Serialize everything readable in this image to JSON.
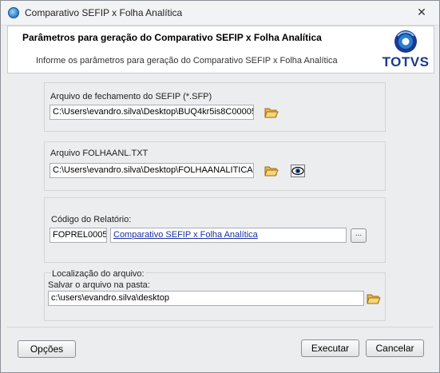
{
  "window": {
    "title": "Comparativo SEFIP x Folha Analítica",
    "close_glyph": "✕",
    "icon": "app-globe-icon"
  },
  "header": {
    "title": "Parâmetros para geração do Comparativo SEFIP x Folha Analítica",
    "subtitle": "Informe os parâmetros para geração do Comparativo SEFIP x Folha Analítica",
    "logo_text": "TOTVS"
  },
  "sefip": {
    "label": "Arquivo de fechamento do SEFIP (*.SFP)",
    "value": "C:\\Users\\evandro.silva\\Desktop\\BUQ4kr5is8C00005"
  },
  "folha": {
    "label": "Arquivo FOLHAANL.TXT",
    "value": "C:\\Users\\evandro.silva\\Desktop\\FOLHAANALITICA"
  },
  "relatorio": {
    "label": "Código do Relatório:",
    "code": "FOPREL0005",
    "description": "Comparativo SEFIP x Folha Analítica",
    "lookup_label": "..."
  },
  "localizacao": {
    "label": "Localização do arquivo:",
    "sublabel": "Salvar o arquivo na pasta:",
    "value": "c:\\users\\evandro.silva\\desktop"
  },
  "buttons": {
    "options_label": "Opções",
    "execute_label": "Executar",
    "cancel_label": "Cancelar"
  },
  "colors": {
    "logo_blue": "#1a3a8f",
    "link_blue": "#1a2fa6",
    "window_bg": "#ecedef"
  }
}
